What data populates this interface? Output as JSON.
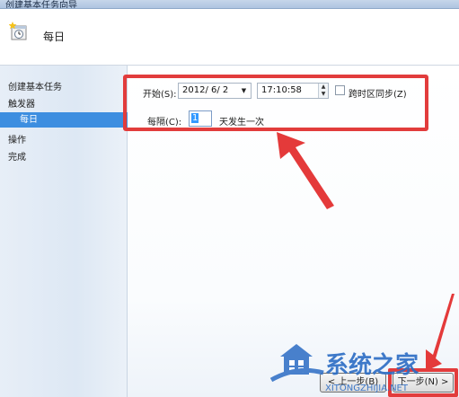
{
  "window": {
    "title": "创建基本任务向导"
  },
  "header": {
    "title": "每日",
    "icon": "clock-task-icon"
  },
  "steps": [
    {
      "label": "创建基本任务"
    },
    {
      "label": "触发器"
    },
    {
      "label": "每日"
    },
    {
      "label": "操作"
    },
    {
      "label": "完成"
    }
  ],
  "form": {
    "start_label": "开始(S):",
    "start_date": "2012/ 6/ 2",
    "start_time": "17:10:58",
    "sync_label": "跨时区同步(Z)",
    "interval_label": "每隔(C):",
    "interval_value": "1",
    "interval_suffix": "天发生一次"
  },
  "buttons": {
    "back_label": "< 上一步(B)",
    "next_label": "下一步(N) >"
  },
  "watermark": {
    "text": "系统之家",
    "text2": "XITONGZHIJIA.NET"
  },
  "colors": {
    "selected_step": "#3d8ee0",
    "highlight": "#e23c3c"
  }
}
